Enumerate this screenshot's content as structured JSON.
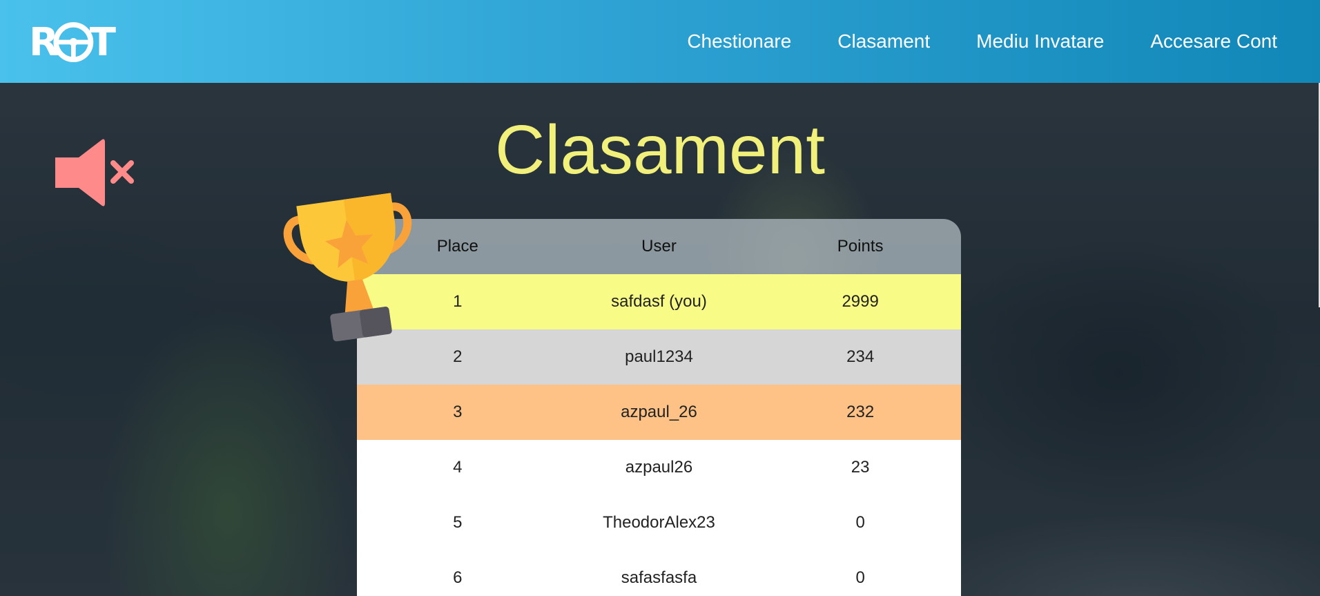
{
  "brand": {
    "logo_text_left": "R",
    "logo_text_right": "T"
  },
  "nav": {
    "items": [
      {
        "label": "Chestionare"
      },
      {
        "label": "Clasament"
      },
      {
        "label": "Mediu Invatare"
      },
      {
        "label": "Accesare Cont"
      }
    ]
  },
  "page": {
    "title": "Clasament"
  },
  "sound": {
    "icon": "speaker-muted-icon",
    "color": "#ff8a8a"
  },
  "leaderboard": {
    "columns": [
      "Place",
      "User",
      "Points"
    ],
    "rows": [
      {
        "place": "1",
        "user": "safdasf (you)",
        "points": "2999"
      },
      {
        "place": "2",
        "user": "paul1234",
        "points": "234"
      },
      {
        "place": "3",
        "user": "azpaul_26",
        "points": "232"
      },
      {
        "place": "4",
        "user": "azpaul26",
        "points": "23"
      },
      {
        "place": "5",
        "user": "TheodorAlex23",
        "points": "0"
      },
      {
        "place": "6",
        "user": "safasfasfa",
        "points": "0"
      }
    ]
  },
  "colors": {
    "title": "#f1f07a",
    "gold_row": "#f8fc86",
    "silver_row": "#d6d6d6",
    "bronze_row": "#fec286"
  }
}
